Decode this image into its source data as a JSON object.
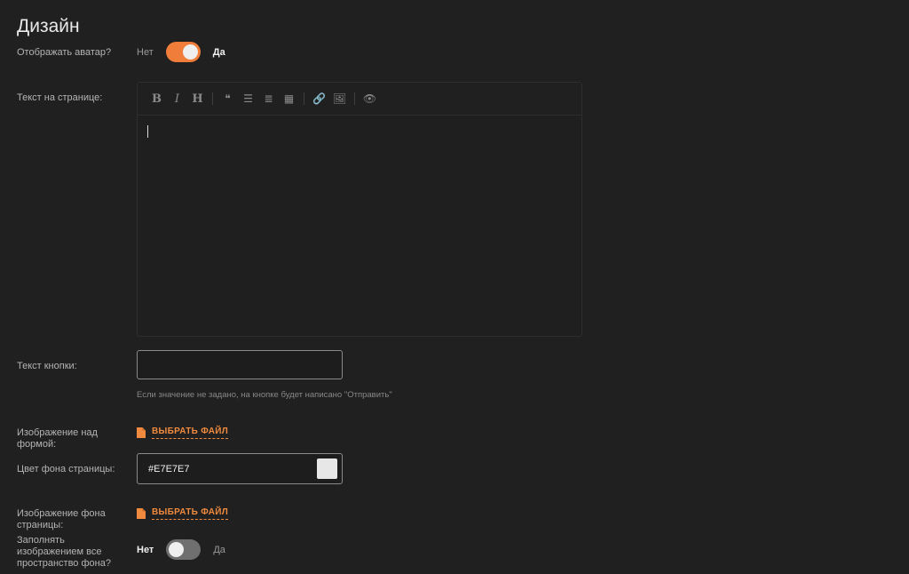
{
  "page": {
    "title": "Дизайн"
  },
  "avatar": {
    "label": "Отображать аватар?",
    "off_label": "Нет",
    "on_label": "Да",
    "enabled": true
  },
  "page_text": {
    "label": "Текст на странице:",
    "toolbar": [
      {
        "name": "bold-icon",
        "glyph": "B",
        "style": "serif"
      },
      {
        "name": "italic-icon",
        "glyph": "I",
        "style": "italic"
      },
      {
        "name": "heading-icon",
        "glyph": "H",
        "style": "serif"
      },
      {
        "sep": true
      },
      {
        "name": "quote-icon",
        "glyph": "❝",
        "style": ""
      },
      {
        "name": "bullet-list-icon",
        "glyph": "☰",
        "style": ""
      },
      {
        "name": "numbered-list-icon",
        "glyph": "≣",
        "style": ""
      },
      {
        "name": "table-icon",
        "glyph": "▦",
        "style": ""
      },
      {
        "sep": true
      },
      {
        "name": "link-icon",
        "glyph": "🔗",
        "style": ""
      },
      {
        "name": "image-icon",
        "glyph": "🖼",
        "style": ""
      },
      {
        "sep": true
      },
      {
        "name": "preview-eye-icon",
        "glyph": "👁",
        "style": ""
      }
    ],
    "value": ""
  },
  "button_text": {
    "label": "Текст кнопки:",
    "value": "",
    "hint": "Если значение не задано, на кнопке будет написано \"Отправить\""
  },
  "form_image": {
    "label": "Изображение над формой:",
    "action": "ВЫБРАТЬ ФАЙЛ"
  },
  "bg_color": {
    "label": "Цвет фона страницы:",
    "value": "#E7E7E7",
    "swatch": "#e7e7e7"
  },
  "bg_image": {
    "label": "Изображение фона страницы:",
    "action": "ВЫБРАТЬ ФАЙЛ"
  },
  "fill_bg": {
    "label": "Заполнять изображением все пространство фона?",
    "off_label": "Нет",
    "on_label": "Да",
    "enabled": false
  },
  "colors": {
    "accent": "#f07d3a",
    "background": "#202020"
  }
}
